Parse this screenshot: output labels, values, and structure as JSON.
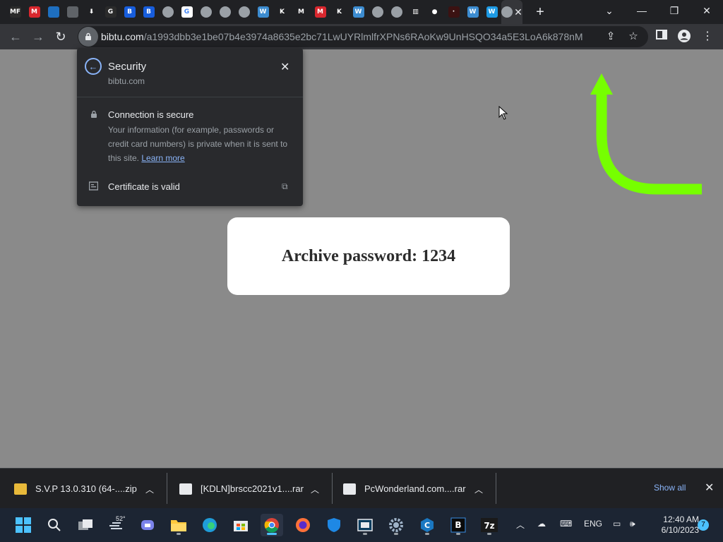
{
  "browser": {
    "tabs": [
      {
        "icon": "mf-icon",
        "badge": "MF",
        "color": "#2b2b2b"
      },
      {
        "icon": "mega-icon",
        "badge": "M",
        "color": "#d9272e"
      },
      {
        "icon": "torrent-icon",
        "badge": "",
        "color": "#1e6fc0"
      },
      {
        "icon": "chrome-icon",
        "badge": "",
        "color": "#5f6368"
      },
      {
        "icon": "download-icon",
        "badge": "⬇",
        "color": "#202124"
      },
      {
        "icon": "g-icon",
        "badge": "G",
        "color": "#2b2b2b"
      },
      {
        "icon": "bitwarden-icon",
        "badge": "B",
        "color": "#175ddc"
      },
      {
        "icon": "bitwarden-icon",
        "badge": "B",
        "color": "#175ddc"
      },
      {
        "icon": "globe-icon",
        "badge": "",
        "color": "#9aa0a6"
      },
      {
        "icon": "google-icon",
        "badge": "G",
        "color": "#ffffff"
      },
      {
        "icon": "globe-icon",
        "badge": "",
        "color": "#9aa0a6"
      },
      {
        "icon": "globe-icon",
        "badge": "",
        "color": "#9aa0a6"
      },
      {
        "icon": "globe-icon",
        "badge": "",
        "color": "#9aa0a6"
      },
      {
        "icon": "wordpress-icon",
        "badge": "W",
        "color": "#3c8cd0"
      },
      {
        "icon": "k-icon",
        "badge": "K",
        "color": "#202124"
      },
      {
        "icon": "m-icon",
        "badge": "M",
        "color": "#202124"
      },
      {
        "icon": "mega-icon",
        "badge": "M",
        "color": "#d9272e"
      },
      {
        "icon": "k-icon",
        "badge": "K",
        "color": "#202124"
      },
      {
        "icon": "wordpress-icon",
        "badge": "W",
        "color": "#3c8cd0"
      },
      {
        "icon": "globe-icon",
        "badge": "",
        "color": "#9aa0a6"
      },
      {
        "icon": "globe-icon",
        "badge": "",
        "color": "#9aa0a6"
      },
      {
        "icon": "library-icon",
        "badge": "▥",
        "color": "#202124"
      },
      {
        "icon": "github-icon",
        "badge": "●",
        "color": "#202124"
      },
      {
        "icon": "dark-icon",
        "badge": "·",
        "color": "#3b1212"
      },
      {
        "icon": "wordpress-icon",
        "badge": "W",
        "color": "#3c8cd0"
      },
      {
        "icon": "w-icon",
        "badge": "W",
        "color": "#1d9ae4"
      }
    ],
    "active_tab_icon": "globe-icon",
    "url_host": "bibtu.com",
    "url_path": "/a1993dbb3e1be07b4e3974a8635e2bc71LwUYRlmlfrXPNs6RAoKw9UnHSQO34a5E3LoA6k878nM"
  },
  "security_popup": {
    "title": "Security",
    "site": "bibtu.com",
    "heading": "Connection is secure",
    "body": "Your information (for example, passwords or credit card numbers) is private when it is sent to this site.",
    "learn_more": "Learn more",
    "certificate": "Certificate is valid"
  },
  "page": {
    "card_text": "Archive password: 1234",
    "arrow_color": "#76ff00",
    "background": "#8a8a8a"
  },
  "downloads": {
    "items": [
      {
        "name": "S.V.P 13.0.310 (64-....zip",
        "icon": "zip-archive-icon"
      },
      {
        "name": "[KDLN]brscc2021v1....rar",
        "icon": "rar-archive-icon"
      },
      {
        "name": "PcWonderland.com....rar",
        "icon": "rar-archive-icon"
      }
    ],
    "show_all": "Show all"
  },
  "taskbar": {
    "weather_temp": "52°",
    "language": "ENG",
    "time": "12:40 AM",
    "date": "6/10/2023",
    "notifications": "7"
  }
}
